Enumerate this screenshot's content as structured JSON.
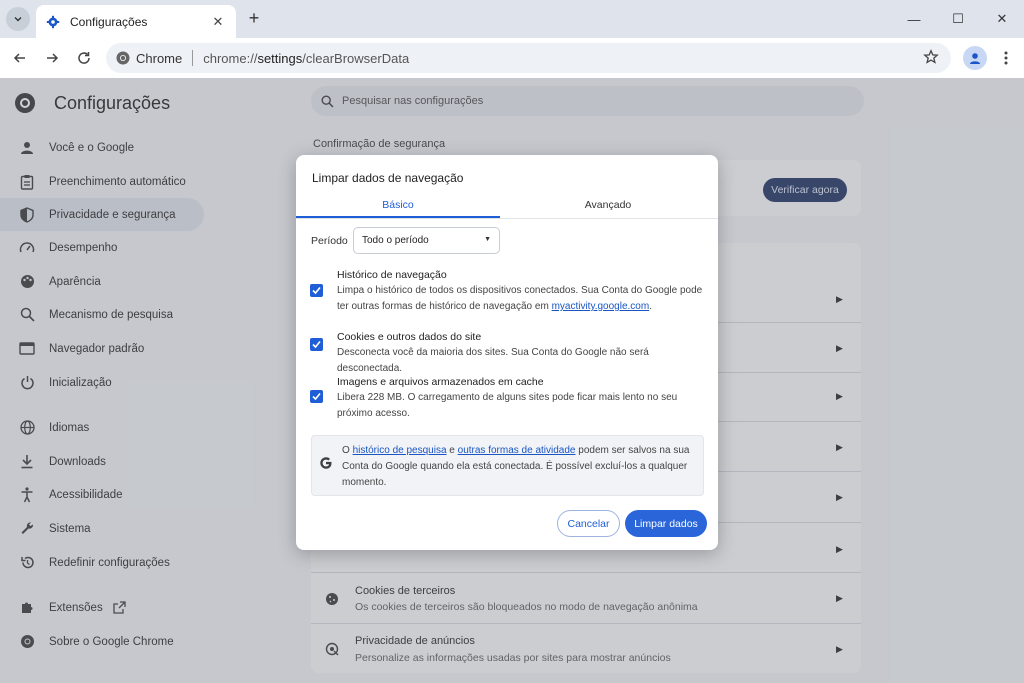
{
  "browser": {
    "tab_title": "Configurações",
    "omnibox_site": "Chrome",
    "url_prefix": "chrome://",
    "url_host": "settings",
    "url_path": "/clearBrowserData"
  },
  "settings": {
    "title": "Configurações",
    "search_placeholder": "Pesquisar nas configurações",
    "section_title": "Confirmação de segurança",
    "verify_button": "Verificar agora",
    "sidebar": [
      {
        "label": "Você e o Google",
        "icon": "person-icon"
      },
      {
        "label": "Preenchimento automático",
        "icon": "clipboard-icon"
      },
      {
        "label": "Privacidade e segurança",
        "icon": "shield-icon"
      },
      {
        "label": "Desempenho",
        "icon": "gauge-icon"
      },
      {
        "label": "Aparência",
        "icon": "palette-icon"
      },
      {
        "label": "Mecanismo de pesquisa",
        "icon": "search-icon"
      },
      {
        "label": "Navegador padrão",
        "icon": "browser-icon"
      },
      {
        "label": "Inicialização",
        "icon": "power-icon"
      },
      {
        "label": "Idiomas",
        "icon": "globe-icon"
      },
      {
        "label": "Downloads",
        "icon": "download-icon"
      },
      {
        "label": "Acessibilidade",
        "icon": "accessibility-icon"
      },
      {
        "label": "Sistema",
        "icon": "wrench-icon"
      },
      {
        "label": "Redefinir configurações",
        "icon": "reset-icon"
      },
      {
        "label": "Extensões",
        "icon": "puzzle-icon"
      },
      {
        "label": "Sobre o Google Chrome",
        "icon": "chrome-icon"
      }
    ],
    "rows": [
      {
        "title": "Cookies de terceiros",
        "subtitle": "Os cookies de terceiros são bloqueados no modo de navegação anônima",
        "icon": "cookie-icon"
      },
      {
        "title": "Privacidade de anúncios",
        "subtitle": "Personalize as informações usadas por sites para mostrar anúncios",
        "icon": "ads-icon"
      }
    ]
  },
  "dialog": {
    "title": "Limpar dados de navegação",
    "tabs": [
      "Básico",
      "Avançado"
    ],
    "period_label": "Período",
    "period_value": "Todo o período",
    "options": [
      {
        "title": "Histórico de navegação",
        "desc": "Limpa o histórico de todos os dispositivos conectados. Sua Conta do Google pode ter outras formas de histórico de navegação em",
        "link": "myactivity.google.com",
        "desc_end": ".",
        "checked": true
      },
      {
        "title": "Cookies e outros dados do site",
        "desc": "Desconecta você da maioria dos sites. Sua Conta do Google não será desconectada.",
        "checked": true
      },
      {
        "title": "Imagens e arquivos armazenados em cache",
        "desc": "Libera 228 MB. O carregamento de alguns sites pode ficar mais lento no seu próximo acesso.",
        "checked": true
      }
    ],
    "info": {
      "prefix": "O",
      "link1": "histórico de pesquisa",
      "mid": "e",
      "link2": "outras formas de atividade",
      "suffix": "podem ser salvos na sua Conta do Google quando ela está conectada. É possível excluí-los a qualquer momento."
    },
    "cancel": "Cancelar",
    "confirm": "Limpar dados"
  },
  "colors": {
    "accent": "#1f5ed6",
    "primary_button": "#2a66d9",
    "verify_button": "#2b3e6a"
  }
}
